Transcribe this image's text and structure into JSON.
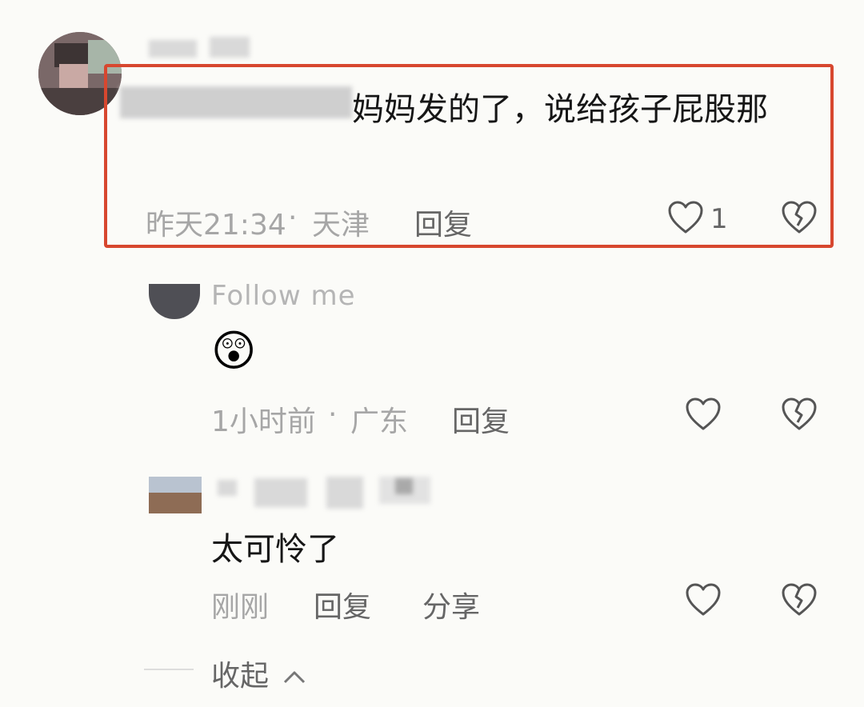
{
  "comments": [
    {
      "text": "妈妈发的了，说给孩子屁股那",
      "time": "昨天21:34",
      "separator": "·",
      "location": "天津",
      "reply_label": "回复",
      "like_count": "1"
    },
    {
      "username": "Follow me",
      "emoji": "😲",
      "time": "1小时前",
      "separator": "·",
      "location": "广东",
      "reply_label": "回复"
    },
    {
      "text": "太可怜了",
      "time": "刚刚",
      "reply_label": "回复",
      "share_label": "分享"
    }
  ],
  "collapse_label": "收起",
  "icons": {
    "like": "heart-outline-icon",
    "dislike": "broken-heart-icon",
    "collapse": "chevron-up-icon"
  },
  "colors": {
    "highlight_border": "#d7472f",
    "meta_text": "#a6a6a6",
    "body_text": "#161616",
    "icon_stroke": "#555555"
  }
}
